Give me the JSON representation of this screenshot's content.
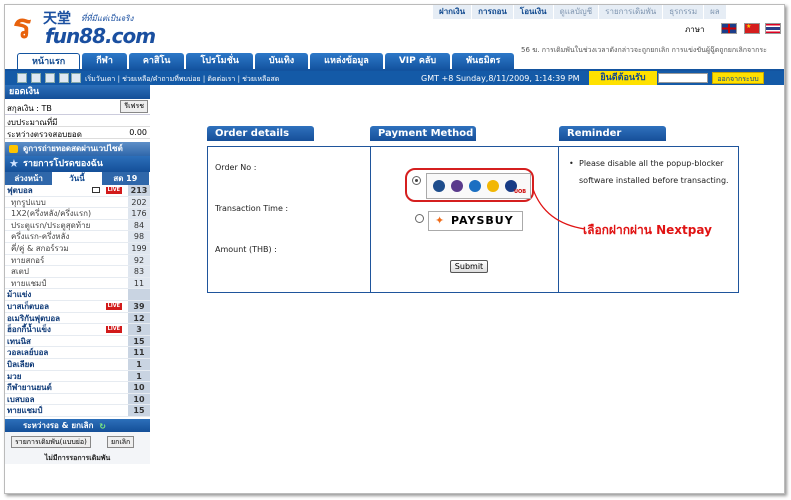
{
  "logo": {
    "mark": "ร",
    "brand_cn": "天堂",
    "brand_domain": "fun88.com",
    "slogan": "ที่ที่มีแต่เป็นจริง"
  },
  "top_links": [
    "ฝากเงิน",
    "การถอน",
    "โอนเงิน",
    "ดูแลบัญชี",
    "รายการเดิมพัน",
    "ธุรกรรม",
    "ผล"
  ],
  "language_label": "ภาษา",
  "marquee": "56 ฆ. การเดิมพันในช่วงเวลาดังกล่าวจะถูกยกเลิก การแข่งขันผู้ฉู๊ดถูกยกเลิกจากระ",
  "nav_tabs": [
    "หน้าแรก",
    "กีฬา",
    "คาสิโน",
    "โปรโมชั่น",
    "บันเทิง",
    "แหล่งข้อมูล",
    "VIP คลับ",
    "พันธมิตร"
  ],
  "subnav": "เริ่มวันเดา | ช่วยเหลือ/คำถามที่พบบ่อย | ติดต่อเรา | ช่วยเหลือสด",
  "clock": "GMT +8 Sunday,8/11/2009, 1:14:39 PM",
  "welcome": "ยินดีต้อนรับ",
  "logout": "ออกจากระบบ",
  "sidebar": {
    "balance_header": "ยอดเงิน",
    "currency": "สกุลเงิน : TB",
    "refresh": "รีเฟรช",
    "pending": "งบประมาณที่มี",
    "pending_value": "",
    "credit_label": "ระหว่างตรวจสอบยอด",
    "credit_value": "0.00",
    "live_banner": "ดูการถ่ายทอดสดผ่านเวปไซต์",
    "fav_header": "รายการโปรดของฉัน",
    "time_tabs": [
      "ล่วงหน้า",
      "วันนี้",
      "สด 19"
    ],
    "sports": [
      {
        "name": "ฟุตบอล",
        "count": "213",
        "kind": "cat",
        "live": true,
        "tv": true
      },
      {
        "name": "ทุกรูปแบบ",
        "count": "202",
        "kind": "sub"
      },
      {
        "name": "1X2(ครึ่งหลัง/ครึ่งแรก)",
        "count": "176",
        "kind": "sub"
      },
      {
        "name": "ประตูแรก/ประตูสุดท้าย",
        "count": "84",
        "kind": "sub"
      },
      {
        "name": "ครึ่งแรก-ครึ่งหลัง",
        "count": "98",
        "kind": "sub"
      },
      {
        "name": "คี่/คู่ & สกอร์รวม",
        "count": "199",
        "kind": "sub"
      },
      {
        "name": "ทายสกอร์",
        "count": "92",
        "kind": "sub"
      },
      {
        "name": "สเตป",
        "count": "83",
        "kind": "sub"
      },
      {
        "name": "ทายแชมป์",
        "count": "11",
        "kind": "sub"
      },
      {
        "name": "ม้าแข่ง",
        "count": "",
        "kind": "cat",
        "horse": true
      },
      {
        "name": "บาสเก็ตบอล",
        "count": "39",
        "kind": "cat",
        "live": true
      },
      {
        "name": "อเมริกันฟุตบอล",
        "count": "12",
        "kind": "cat"
      },
      {
        "name": "ฮ็อกกี้น้ำแข็ง",
        "count": "3",
        "kind": "cat",
        "live": true
      },
      {
        "name": "เทนนิส",
        "count": "15",
        "kind": "cat"
      },
      {
        "name": "วอลเลย์บอล",
        "count": "11",
        "kind": "cat"
      },
      {
        "name": "บิลเลียด",
        "count": "1",
        "kind": "cat"
      },
      {
        "name": "มวย",
        "count": "1",
        "kind": "cat"
      },
      {
        "name": "กีฬายานยนต์",
        "count": "10",
        "kind": "cat"
      },
      {
        "name": "เบสบอล",
        "count": "10",
        "kind": "cat"
      },
      {
        "name": "ทายแชมป์",
        "count": "15",
        "kind": "cat"
      }
    ],
    "pending_header": "ระหว่างรอ & ยกเลิก",
    "bets_button": "รายการเดิมพัน(แบบย่อ)",
    "cancel_button": "ยกเลิก",
    "no_items": "ไม่มีการรอการเดิมพัน"
  },
  "order": {
    "header": "Order details",
    "order_no": "Order No :",
    "txn_time": "Transaction Time :",
    "amount": "Amount (THB) :"
  },
  "payment": {
    "header": "Payment Method",
    "paysbuy": "PAYSBUY",
    "submit": "Submit",
    "bank_uob": "UOB"
  },
  "reminder": {
    "header": "Reminder",
    "text": "Please disable all the popup-blocker software installed before transacting."
  },
  "annotation": "เลือกฝากผ่าน Nextpay",
  "colors": {
    "primary": "#13539f",
    "accent": "#ffe100",
    "annotation": "#e01313"
  }
}
